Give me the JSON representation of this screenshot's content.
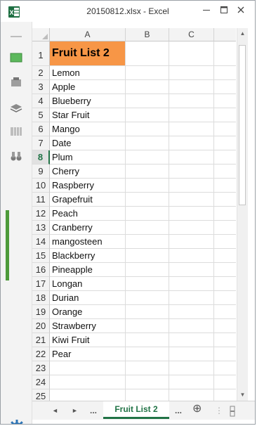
{
  "window": {
    "title": "20150812.xlsx - Excel",
    "app_icon": "excel-icon",
    "minimize_icon": "minimize-icon",
    "maximize_icon": "maximize-icon",
    "close_icon": "close-icon"
  },
  "rail": {
    "items": [
      "sheet-icon",
      "clipboard-icon",
      "layers-icon",
      "columns-icon",
      "binoculars-icon"
    ],
    "settings_icon": "gear-icon",
    "colors": {
      "accent": "#217346",
      "rail_tab": "#4d9a3a",
      "settings": "#2e75b6"
    }
  },
  "grid": {
    "columns": [
      "A",
      "B",
      "C"
    ],
    "selected_row": "8",
    "header_cell": "Fruit  List 2",
    "header_color": "#f79646",
    "rows": [
      {
        "num": "1",
        "a": "Fruit  List 2"
      },
      {
        "num": "2",
        "a": "Lemon"
      },
      {
        "num": "3",
        "a": "Apple"
      },
      {
        "num": "4",
        "a": "Blueberry"
      },
      {
        "num": "5",
        "a": "Star Fruit"
      },
      {
        "num": "6",
        "a": "Mango"
      },
      {
        "num": "7",
        "a": "Date"
      },
      {
        "num": "8",
        "a": "Plum"
      },
      {
        "num": "9",
        "a": "Cherry"
      },
      {
        "num": "10",
        "a": "Raspberry"
      },
      {
        "num": "11",
        "a": "Grapefruit"
      },
      {
        "num": "12",
        "a": "Peach"
      },
      {
        "num": "13",
        "a": "Cranberry"
      },
      {
        "num": "14",
        "a": "mangosteen"
      },
      {
        "num": "15",
        "a": "Blackberry"
      },
      {
        "num": "16",
        "a": "Pineapple"
      },
      {
        "num": "17",
        "a": "Longan"
      },
      {
        "num": "18",
        "a": "Durian"
      },
      {
        "num": "19",
        "a": "Orange"
      },
      {
        "num": "20",
        "a": "Strawberry"
      },
      {
        "num": "21",
        "a": "Kiwi Fruit"
      },
      {
        "num": "22",
        "a": "Pear"
      },
      {
        "num": "23",
        "a": ""
      },
      {
        "num": "24",
        "a": ""
      },
      {
        "num": "25",
        "a": ""
      }
    ]
  },
  "tabs": {
    "prev": "◄",
    "next": "►",
    "more_left": "...",
    "active_sheet": "Fruit List 2",
    "more_right": "...",
    "add": "⊕"
  }
}
